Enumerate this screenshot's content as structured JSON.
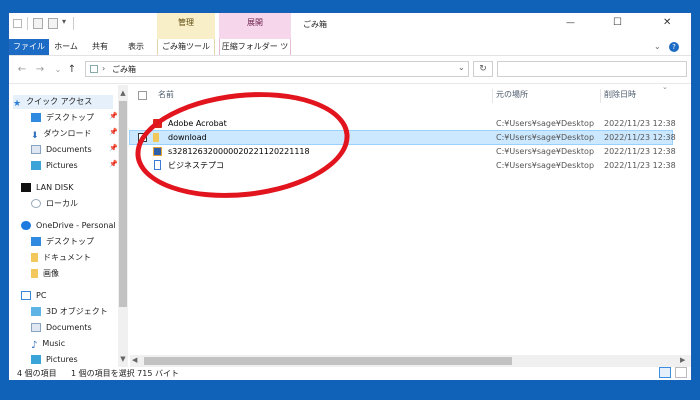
{
  "window": {
    "title": "ごみ箱"
  },
  "title_controls": {
    "minimize": "—",
    "maximize": "☐",
    "close": "✕"
  },
  "context_tabs": {
    "manage": "管理",
    "extract": "展開"
  },
  "ribbon_tabs": {
    "file": "ファイル",
    "home": "ホーム",
    "share": "共有",
    "view": "表示",
    "recycle_tools": "ごみ箱ツール",
    "zip_tools": "圧縮フォルダー ツール"
  },
  "address": {
    "path": "ごみ箱"
  },
  "nav": {
    "quick_access": "クイック アクセス",
    "desktop": "デスクトップ",
    "downloads": "ダウンロード",
    "documents": "Documents",
    "pictures": "Pictures",
    "lan_disk": "LAN DISK",
    "local": "ローカル",
    "onedrive": "OneDrive - Personal",
    "od_desktop": "デスクトップ",
    "od_documents": "ドキュメント",
    "od_images": "画像",
    "pc": "PC",
    "objects3d": "3D オブジェクト",
    "pc_documents": "Documents",
    "music": "Music",
    "pc_pictures": "Pictures"
  },
  "columns": {
    "name": "名前",
    "location": "元の場所",
    "date": "削除日時"
  },
  "files": [
    {
      "name": "Adobe Acrobat",
      "location": "C:¥Users¥sage¥Desktop",
      "date": "2022/11/23 12:38",
      "icon": "acrobat-icon",
      "icon_color": "#d9241c"
    },
    {
      "name": "download",
      "location": "C:¥Users¥sage¥Desktop",
      "date": "2022/11/23 12:38",
      "icon": "folder-icon",
      "icon_color": "#f2c75c"
    },
    {
      "name": "s328126320000020221120221118",
      "location": "C:¥Users¥sage¥Desktop",
      "date": "2022/11/23 12:38",
      "icon": "image-icon",
      "icon_color": "#2f5fa8"
    },
    {
      "name": "ビジネステプコ",
      "location": "C:¥Users¥sage¥Desktop",
      "date": "2022/11/23 12:38",
      "icon": "document-icon",
      "icon_color": "#3a7bd5"
    }
  ],
  "status": {
    "count": "4 個の項目",
    "selected": "1 個の項目を選択  715 バイト"
  },
  "colors": {
    "accent": "#0f62b8",
    "selection": "#cce8ff",
    "annotation": "#e2141e"
  }
}
